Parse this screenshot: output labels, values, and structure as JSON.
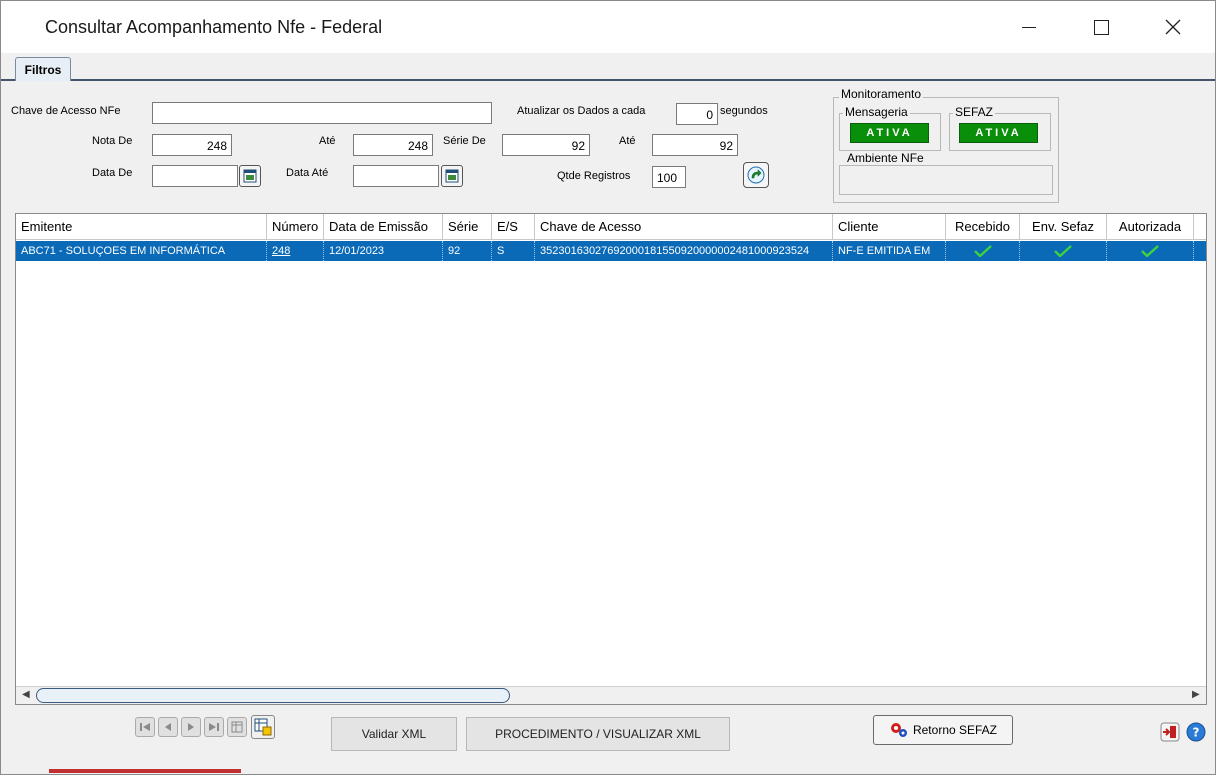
{
  "window": {
    "title": "Consultar Acompanhamento Nfe - Federal"
  },
  "tabs": [
    {
      "label": "Filtros"
    }
  ],
  "filters": {
    "chave_label": "Chave de Acesso NFe",
    "chave_value": "",
    "nota_de_label": "Nota De",
    "nota_de_value": "248",
    "nota_ate_label": "Até",
    "nota_ate_value": "248",
    "serie_de_label": "Série De",
    "serie_de_value": "92",
    "serie_ate_label": "Até",
    "serie_ate_value": "92",
    "data_de_label": "Data De",
    "data_de_value": "",
    "data_ate_label": "Data Até",
    "data_ate_value": "",
    "atualizar_label": "Atualizar os Dados a cada",
    "atualizar_value": "0",
    "segundos_label": "segundos",
    "qtde_label": "Qtde Registros",
    "qtde_value": "100"
  },
  "monitor": {
    "title": "Monitoramento",
    "mensageria_label": "Mensageria",
    "mensageria_status": "ATIVA",
    "sefaz_label": "SEFAZ",
    "sefaz_status": "ATIVA",
    "ambiente_label": "Ambiente NFe",
    "status_color": "#0a8f0a"
  },
  "grid": {
    "columns": [
      "Emitente",
      "Número",
      "Data de Emissão",
      "Série",
      "E/S",
      "Chave de Acesso",
      "Cliente",
      "Recebido",
      "Env. Sefaz",
      "Autorizada"
    ],
    "rows": [
      {
        "emitente": "ABC71 - SOLUÇOES EM INFORMÁTICA",
        "numero": "248",
        "data_emissao": "12/01/2023",
        "serie": "92",
        "es": "S",
        "chave": "35230163027692000181550920000002481000923524",
        "cliente": "NF-E EMITIDA EM",
        "recebido": "check-icon",
        "env_sefaz": "check-icon",
        "autorizada": "check-icon"
      }
    ],
    "selected_color": "#0a6ab8"
  },
  "actions": {
    "validar_label": "Validar XML",
    "procedimento_label": "PROCEDIMENTO / VISUALIZAR XML",
    "retorno_label": "Retorno SEFAZ"
  }
}
